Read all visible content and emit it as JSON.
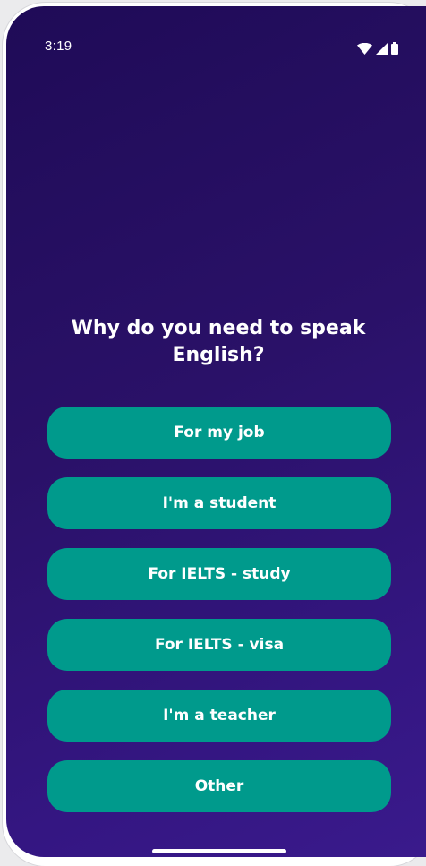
{
  "status_bar": {
    "time": "3:19",
    "icons": [
      "wifi-icon",
      "signal-icon",
      "battery-icon"
    ]
  },
  "question": {
    "title": "Why do you need to speak English?"
  },
  "options": [
    {
      "label": "For my job"
    },
    {
      "label": "I'm a student"
    },
    {
      "label": "For IELTS - study"
    },
    {
      "label": "For IELTS - visa"
    },
    {
      "label": "I'm a teacher"
    },
    {
      "label": "Other"
    }
  ],
  "colors": {
    "background_top": "#1f0b57",
    "background_bottom": "#3a1a8c",
    "button": "#009a8c",
    "text": "#ffffff"
  }
}
